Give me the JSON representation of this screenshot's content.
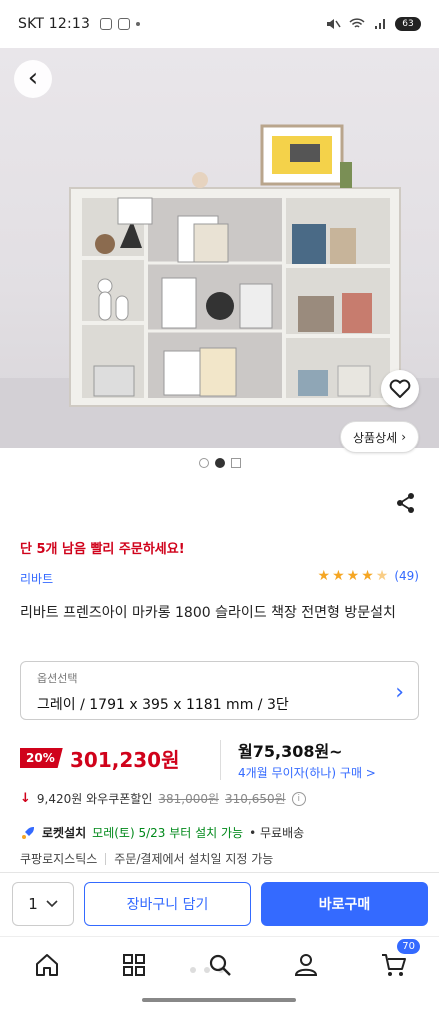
{
  "status_bar": {
    "time": "SKT 12:13",
    "battery": "63"
  },
  "product": {
    "urgency": "단 5개 남음 빨리 주문하세요!",
    "brand": "리바트",
    "rating": 4.5,
    "rating_count": "(49)",
    "title": "리바트 프렌즈아이 마카롱 1800 슬라이드 책장 전면형 방문설치",
    "detail_button": "상품상세"
  },
  "option": {
    "label": "옵션선택",
    "value": "그레이 / 1791 x 395 x 1181 mm / 3단"
  },
  "price": {
    "discount": "20%",
    "sale_price": "301,230원",
    "monthly": "월75,308원~",
    "installment": "4개월 무이자(하나) 구매 >"
  },
  "coupon": {
    "amount": "9,420원 와우쿠폰할인",
    "original": "381,000원",
    "before_coupon": "310,650원"
  },
  "delivery": {
    "label": "로켓설치",
    "date": "모레(토) 5/23 부터 설치 가능",
    "free": "• 무료배송"
  },
  "logistics": {
    "company": "쿠팡로지스틱스",
    "note": "주문/결제에서 설치일 지정 가능"
  },
  "actions": {
    "quantity": "1",
    "cart_label": "장바구니 담기",
    "buy_label": "바로구매"
  },
  "nav": {
    "cart_count": "70"
  },
  "colors": {
    "accent": "#346aff",
    "sale": "#d0021b",
    "rocket_green": "#00891a"
  }
}
